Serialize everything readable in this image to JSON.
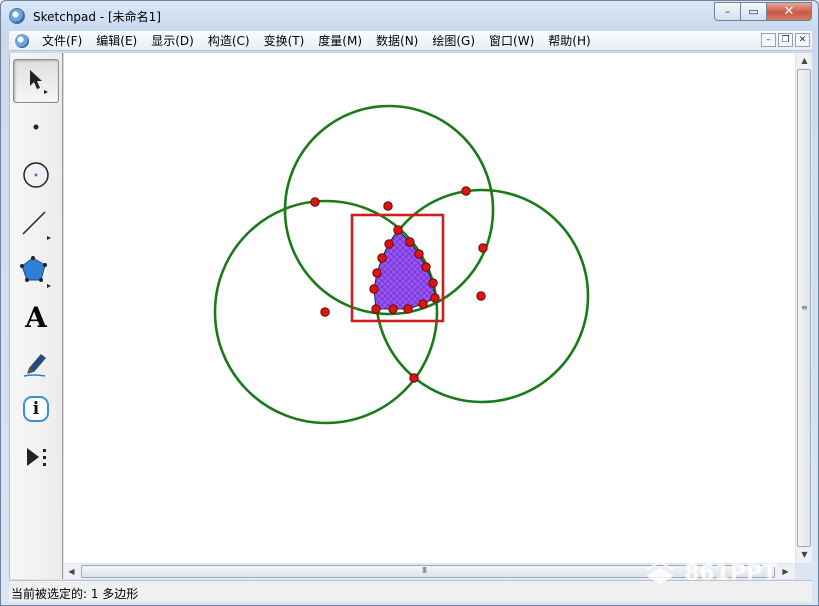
{
  "window": {
    "title": "Sketchpad  - [未命名1]",
    "controls": {
      "minimize": "–",
      "maximize": "▭",
      "close": "✕"
    }
  },
  "menu": {
    "items": [
      {
        "id": "file",
        "label": "文件(F)"
      },
      {
        "id": "edit",
        "label": "编辑(E)"
      },
      {
        "id": "display",
        "label": "显示(D)"
      },
      {
        "id": "construct",
        "label": "构造(C)"
      },
      {
        "id": "transform",
        "label": "变换(T)"
      },
      {
        "id": "measure",
        "label": "度量(M)"
      },
      {
        "id": "number",
        "label": "数据(N)"
      },
      {
        "id": "graph",
        "label": "绘图(G)"
      },
      {
        "id": "window",
        "label": "窗口(W)"
      },
      {
        "id": "help",
        "label": "帮助(H)"
      }
    ],
    "doc_controls": {
      "minimize": "–",
      "restore": "❐",
      "close": "✕"
    }
  },
  "toolbox": {
    "tools": [
      {
        "id": "arrow",
        "icon": "selection-arrow-icon",
        "selected": true
      },
      {
        "id": "point",
        "icon": "point-tool-icon",
        "selected": false
      },
      {
        "id": "compass",
        "icon": "compass-tool-icon",
        "selected": false
      },
      {
        "id": "straightedge",
        "icon": "straightedge-tool-icon",
        "selected": false
      },
      {
        "id": "polygon",
        "icon": "polygon-tool-icon",
        "selected": false
      },
      {
        "id": "text",
        "icon": "text-tool-icon",
        "label": "A",
        "selected": false
      },
      {
        "id": "marker",
        "icon": "marker-tool-icon",
        "selected": false
      },
      {
        "id": "info",
        "icon": "information-tool-icon",
        "label": "i",
        "selected": false
      },
      {
        "id": "custom",
        "icon": "custom-tool-icon",
        "selected": false
      }
    ]
  },
  "scrollbars": {
    "h_grip": "III",
    "v_grip": "≡"
  },
  "status": {
    "text": "当前被选定的: 1 多边形"
  },
  "watermark": {
    "text": "861PPT"
  },
  "colors": {
    "circle": "#1a7a1a",
    "point": "#d91616",
    "polygon_fill": "#9a55f0",
    "rect": "#cc1f1f"
  }
}
